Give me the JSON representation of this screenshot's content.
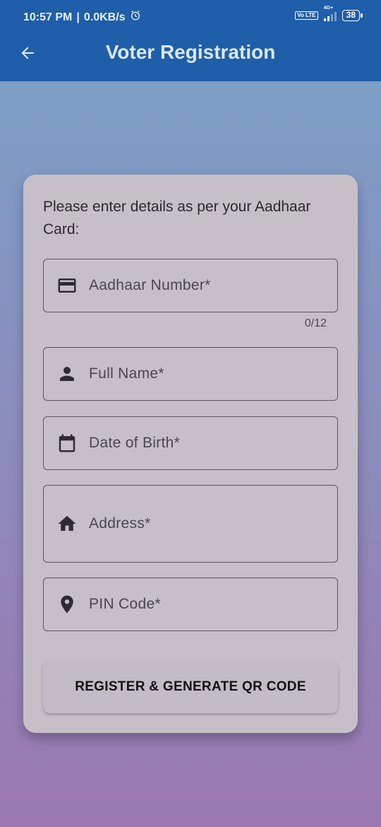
{
  "status_bar": {
    "time": "10:57 PM",
    "separator": "|",
    "speed": "0.0KB/s",
    "alarm_icon": "alarm-icon",
    "volte": "Vo LTE",
    "network": "4G+",
    "battery": "38"
  },
  "app_bar": {
    "title": "Voter Registration",
    "back_icon": "arrow-back-icon"
  },
  "form": {
    "instructions": "Please enter details as per your Aadhaar Card:",
    "fields": [
      {
        "label": "Aadhaar Number*",
        "icon": "credit-card-icon",
        "counter": "0/12"
      },
      {
        "label": "Full Name*",
        "icon": "person-icon"
      },
      {
        "label": "Date of Birth*",
        "icon": "calendar-icon"
      },
      {
        "label": "Address*",
        "icon": "home-icon"
      },
      {
        "label": "PIN Code*",
        "icon": "location-pin-icon"
      }
    ],
    "submit_label": "REGISTER & GENERATE QR CODE"
  },
  "colors": {
    "app_bar": "#1f5ea8",
    "card": "#c6bfc8",
    "icon": "#2f2b33"
  }
}
